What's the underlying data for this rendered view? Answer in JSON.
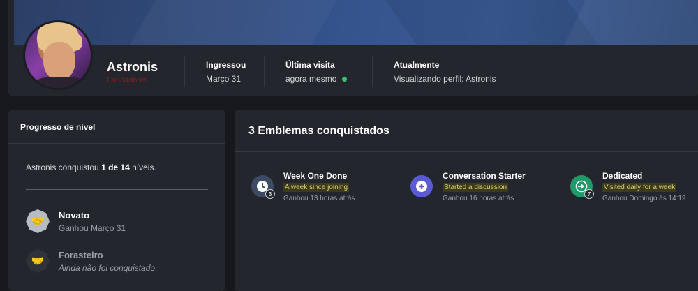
{
  "profile": {
    "username": "Astronis",
    "user_title": "Fundadores",
    "stats": [
      {
        "label": "Ingressou",
        "value": "Março 31"
      },
      {
        "label": "Última visita",
        "value": "agora mesmo"
      },
      {
        "label": "Atualmente",
        "value": "Visualizando perfil: Astronis"
      }
    ],
    "online_color": "#36c46b"
  },
  "level_progress": {
    "title": "Progresso de nível",
    "summary_prefix": "Astronis conquistou ",
    "summary_bold": "1 de 14",
    "summary_suffix": " níveis.",
    "levels": [
      {
        "name": "Novato",
        "status": "Ganhou Março 31",
        "icon": "handshake-icon"
      },
      {
        "name": "Forasteiro",
        "status": "Ainda não foi conquistado",
        "icon": "handshake-icon"
      }
    ]
  },
  "badges": {
    "title": "3 Emblemas conquistados",
    "items": [
      {
        "name": "Week One Done",
        "description": "A week since joining",
        "earned": "Ganhou 13 horas atrás",
        "count": "3",
        "icon": "clock-icon",
        "color": "#3d4a63"
      },
      {
        "name": "Conversation Starter",
        "description": "Started a discussion",
        "earned": "Ganhou 16 horas atrás",
        "count": "",
        "icon": "plus-circle-icon",
        "color": "#5a5bd4"
      },
      {
        "name": "Dedicated",
        "description": "Visited daily for a week",
        "earned": "Ganhou Domingo às 14:19",
        "count": "7",
        "icon": "sign-in-icon",
        "color": "#1f9a68"
      }
    ]
  }
}
